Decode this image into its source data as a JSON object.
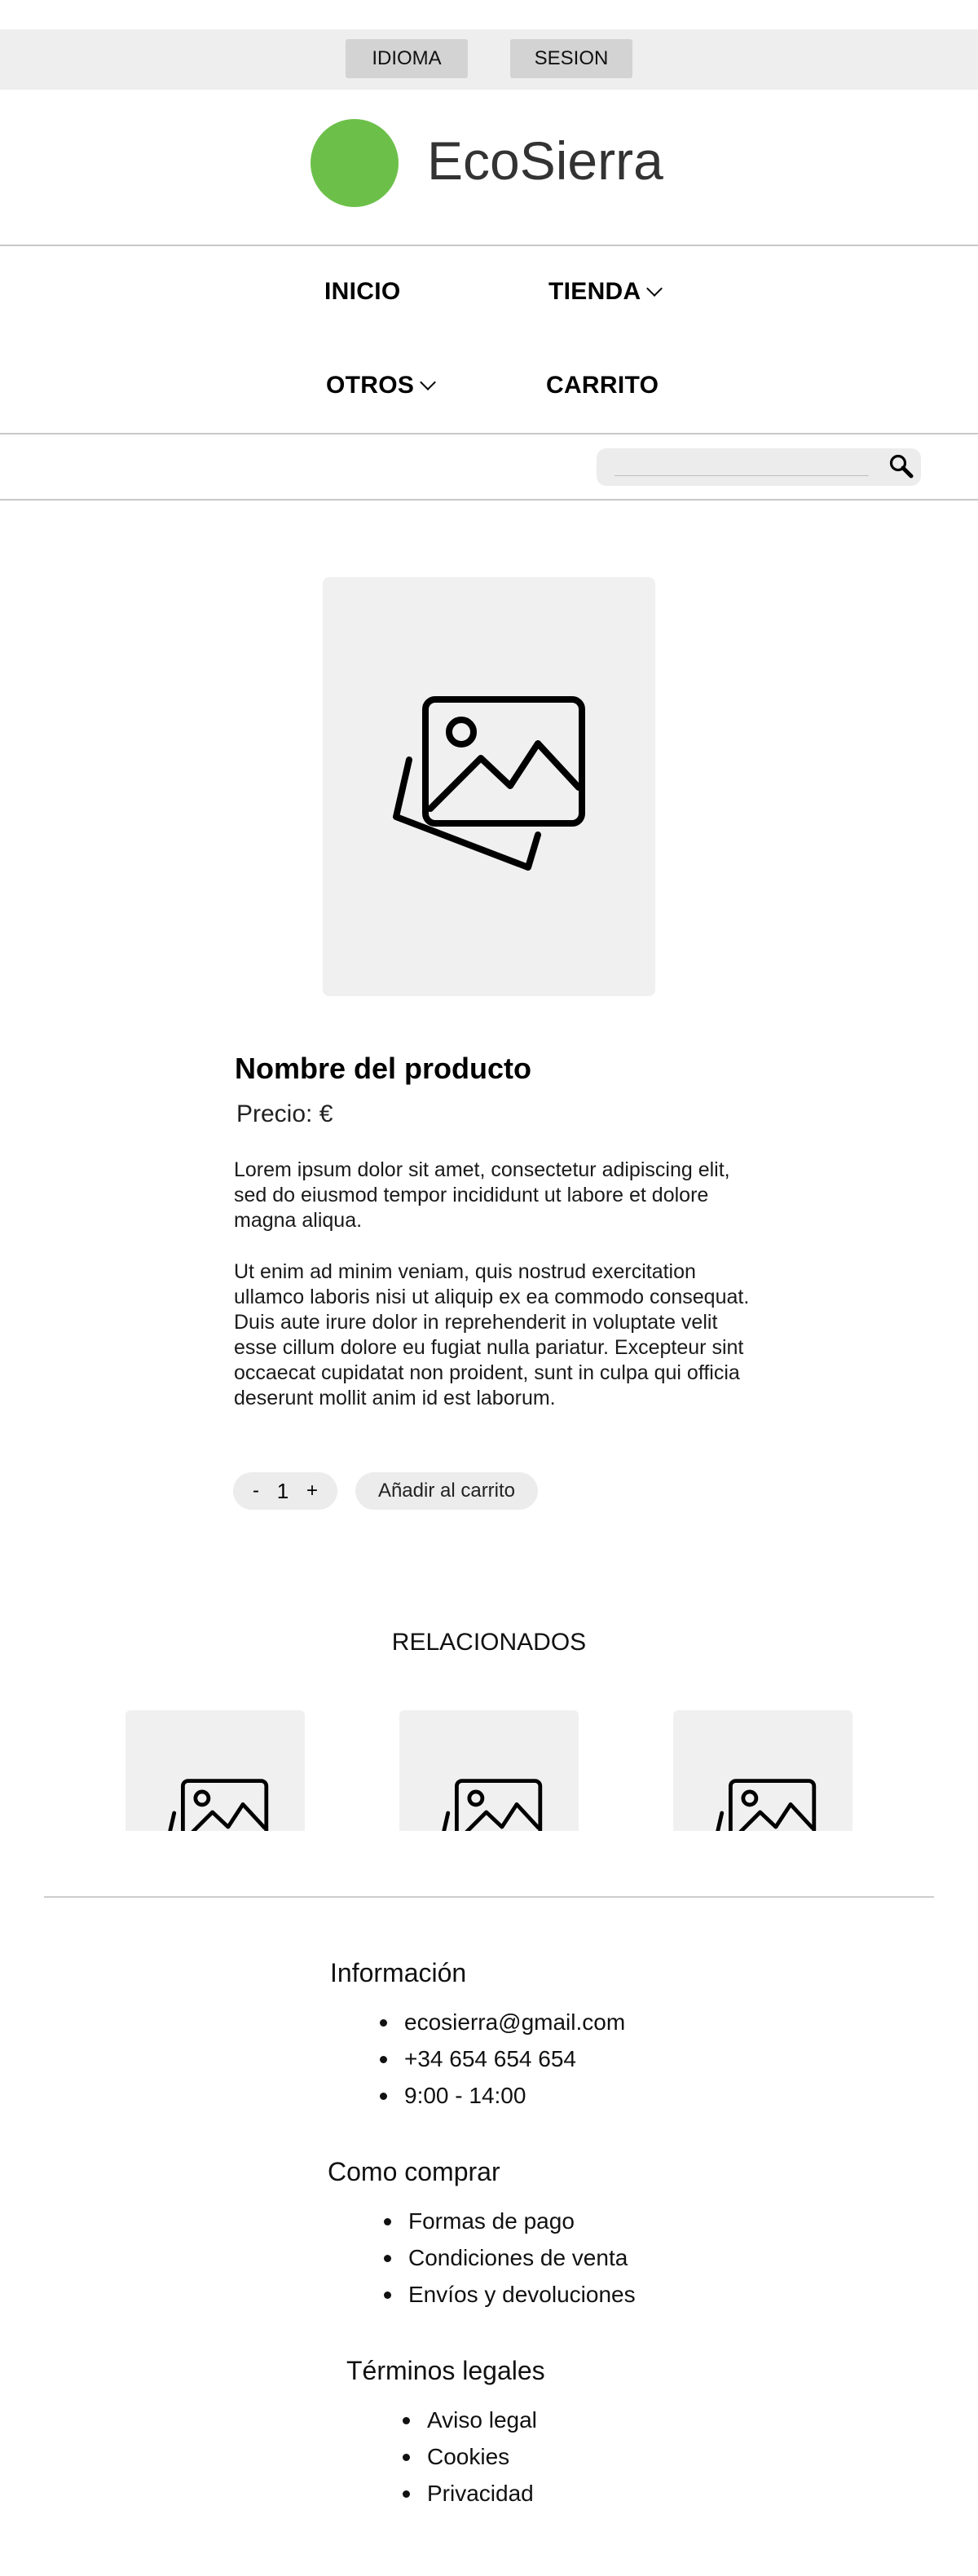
{
  "topbar": {
    "language_label": "IDIOMA",
    "session_label": "SESION"
  },
  "brand": {
    "name": "EcoSierra",
    "logo_color": "#6cc04a"
  },
  "nav": {
    "inicio": "INICIO",
    "tienda": "TIENDA",
    "otros": "OTROS",
    "carrito": "CARRITO"
  },
  "search": {
    "placeholder": "",
    "icon": "search-icon"
  },
  "product": {
    "image_icon": "image-placeholder-icon",
    "name": "Nombre del producto",
    "price": "Precio: €",
    "description_1": "Lorem ipsum dolor sit amet, consectetur adipiscing elit, sed do eiusmod tempor incididunt ut labore et dolore magna aliqua.",
    "description_2": "Ut enim ad minim veniam, quis nostrud exercitation ullamco laboris nisi ut aliquip ex ea commodo consequat. Duis aute irure dolor in reprehenderit in voluptate velit esse cillum dolore eu fugiat nulla pariatur. Excepteur sint occaecat cupidatat non proident, sunt in culpa qui officia deserunt mollit anim id est laborum.",
    "qty_minus": "-",
    "qty_value": "1",
    "qty_plus": "+",
    "add_to_cart": "Añadir al carrito"
  },
  "related": {
    "title": "RELACIONADOS"
  },
  "footer": {
    "info": {
      "title": "Información",
      "items": [
        "ecosierra@gmail.com",
        "+34 654 654 654",
        "9:00 - 14:00"
      ]
    },
    "how_to_buy": {
      "title": "Como comprar",
      "items": [
        "Formas de pago",
        "Condiciones de venta",
        "Envíos y devoluciones"
      ]
    },
    "legal": {
      "title": "Términos legales",
      "items": [
        "Aviso legal",
        "Cookies",
        "Privacidad"
      ]
    }
  }
}
